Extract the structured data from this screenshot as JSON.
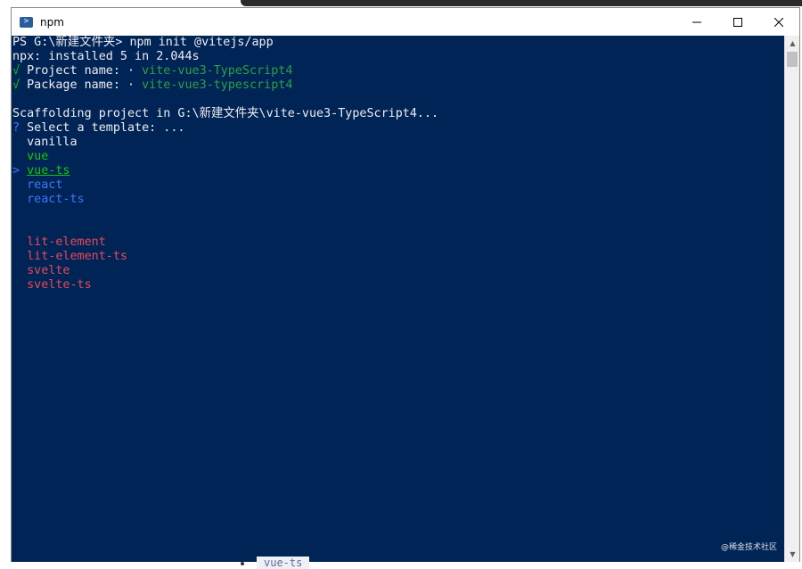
{
  "window": {
    "title": "npm",
    "minimize_label": "minimize",
    "maximize_label": "maximize",
    "close_label": "close"
  },
  "terminal": {
    "lines": [
      {
        "segments": [
          {
            "text": "PS G:\\新建文件夹> npm init @vitejs/app",
            "cls": "w"
          }
        ]
      },
      {
        "segments": [
          {
            "text": "npx: installed 5 in 2.044s",
            "cls": "w"
          }
        ]
      },
      {
        "segments": [
          {
            "text": "√ ",
            "cls": "g"
          },
          {
            "text": "Project name: ",
            "cls": "w"
          },
          {
            "text": "· ",
            "cls": "w"
          },
          {
            "text": "vite-vue3-TypeScript4",
            "cls": "gdim"
          }
        ]
      },
      {
        "segments": [
          {
            "text": "√ ",
            "cls": "g"
          },
          {
            "text": "Package name: ",
            "cls": "w"
          },
          {
            "text": "· ",
            "cls": "w"
          },
          {
            "text": "vite-vue3-typescript4",
            "cls": "gdim"
          }
        ]
      },
      {
        "segments": [
          {
            "text": "",
            "cls": "w"
          }
        ]
      },
      {
        "segments": [
          {
            "text": "Scaffolding project in G:\\新建文件夹\\vite-vue3-TypeScript4...",
            "cls": "w"
          }
        ]
      },
      {
        "segments": [
          {
            "text": "? ",
            "cls": "b"
          },
          {
            "text": "Select a template: ...",
            "cls": "w"
          }
        ]
      },
      {
        "segments": [
          {
            "text": "  vanilla",
            "cls": "w"
          }
        ]
      },
      {
        "segments": [
          {
            "text": "  vue",
            "cls": "g"
          }
        ]
      },
      {
        "segments": [
          {
            "text": "> ",
            "cls": "b"
          },
          {
            "text": "vue-ts",
            "cls": "g u"
          }
        ]
      },
      {
        "segments": [
          {
            "text": "  react",
            "cls": "b"
          }
        ]
      },
      {
        "segments": [
          {
            "text": "  react-ts",
            "cls": "b"
          }
        ]
      },
      {
        "segments": [
          {
            "text": "",
            "cls": "w"
          }
        ]
      },
      {
        "segments": [
          {
            "text": "",
            "cls": "w"
          }
        ]
      },
      {
        "segments": [
          {
            "text": "  lit-element",
            "cls": "r"
          }
        ]
      },
      {
        "segments": [
          {
            "text": "  lit-element-ts",
            "cls": "r"
          }
        ]
      },
      {
        "segments": [
          {
            "text": "  svelte",
            "cls": "r"
          }
        ]
      },
      {
        "segments": [
          {
            "text": "  svelte-ts",
            "cls": "r"
          }
        ]
      }
    ]
  },
  "watermark": "@稀金技术社区",
  "behind_text": "vue-ts",
  "colors": {
    "terminal_bg": "#012456",
    "green": "#16c60c",
    "blue": "#3b78ff",
    "red": "#e74856",
    "white": "#eeedf0"
  }
}
